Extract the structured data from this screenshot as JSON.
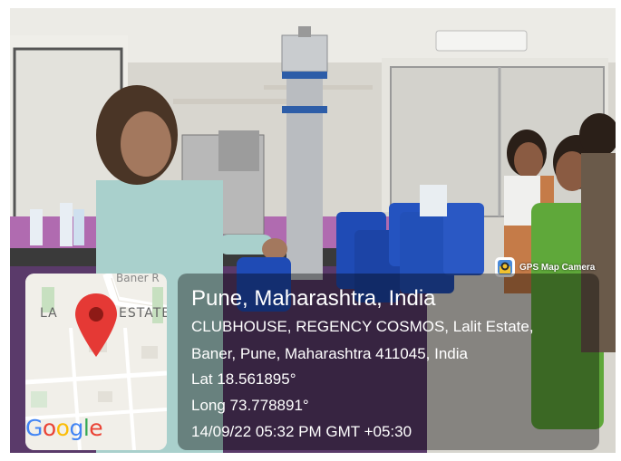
{
  "photo": {
    "description_icon": "photo-scene"
  },
  "badge": {
    "label": "GPS Map Camera",
    "icon": "gps-map-camera-icon"
  },
  "map": {
    "road_label": "Baner R",
    "area_label_start": "LA",
    "area_label_end": "ESTATE",
    "pin_icon": "map-pin-icon",
    "logo": [
      "G",
      "o",
      "o",
      "g",
      "l",
      "e"
    ],
    "logo_colors": [
      "#4285F4",
      "#EA4335",
      "#FBBC05",
      "#4285F4",
      "#34A853",
      "#EA4335"
    ]
  },
  "location": {
    "title": "Pune, Maharashtra, India",
    "address_line1": "CLUBHOUSE, REGENCY COSMOS, Lalit Estate,",
    "address_line2": "Baner, Pune, Maharashtra 411045, India",
    "latitude": "Lat 18.561895°",
    "longitude": "Long 73.778891°",
    "timestamp": "14/09/22 05:32 PM GMT +05:30"
  }
}
